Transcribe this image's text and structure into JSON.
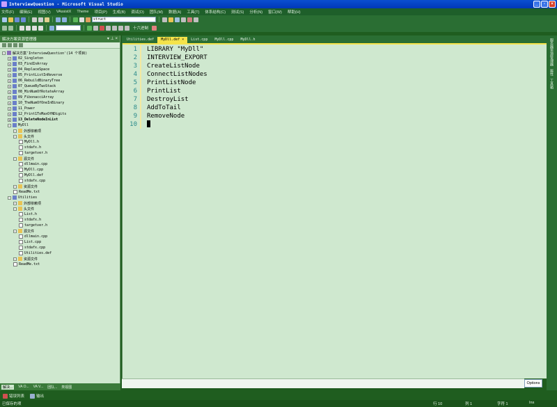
{
  "window": {
    "title": "InterviewQuestion - Microsoft Visual Studio"
  },
  "menu": [
    "文件(F)",
    "编辑(E)",
    "视图(V)",
    "VAssistX",
    "Theme",
    "项目(P)",
    "生成(B)",
    "调试(D)",
    "团队(M)",
    "数据(A)",
    "工具(T)",
    "体系结构(C)",
    "测试(S)",
    "分析(N)",
    "窗口(W)",
    "帮助(H)"
  ],
  "toolbar": {
    "find_combo": "struct",
    "hex_label": "十六进制"
  },
  "solution_explorer": {
    "header": "解决方案资源管理器",
    "rows": [
      {
        "text": "解决方案'InterviewQuestion'(14 个项目)",
        "level": 0,
        "type": "sol",
        "bold": false
      },
      {
        "text": "02_Singleton",
        "level": 1,
        "type": "proj"
      },
      {
        "text": "03_FindInArray",
        "level": 1,
        "type": "proj"
      },
      {
        "text": "04_ReplaceSpace",
        "level": 1,
        "type": "proj"
      },
      {
        "text": "05_PrintListInReverse",
        "level": 1,
        "type": "proj"
      },
      {
        "text": "06_RebuildBinaryTree",
        "level": 1,
        "type": "proj"
      },
      {
        "text": "07_QueueByTwoStack",
        "level": 1,
        "type": "proj"
      },
      {
        "text": "08_MinNumOfRotateArray",
        "level": 1,
        "type": "proj"
      },
      {
        "text": "09_FibonacciArray",
        "level": 1,
        "type": "proj"
      },
      {
        "text": "10_TheNumOfOneInBinary",
        "level": 1,
        "type": "proj"
      },
      {
        "text": "11_Power",
        "level": 1,
        "type": "proj"
      },
      {
        "text": "12_Print1ToMaxOfNDigits",
        "level": 1,
        "type": "proj"
      },
      {
        "text": "13_DeleteNodeInList",
        "level": 1,
        "type": "proj",
        "bold": true
      },
      {
        "text": "MyDll",
        "level": 1,
        "type": "proj"
      },
      {
        "text": "外部依赖项",
        "level": 2,
        "type": "folder"
      },
      {
        "text": "头文件",
        "level": 2,
        "type": "folder"
      },
      {
        "text": "MyDll.h",
        "level": 3,
        "type": "file"
      },
      {
        "text": "stdafx.h",
        "level": 3,
        "type": "file"
      },
      {
        "text": "targetver.h",
        "level": 3,
        "type": "file"
      },
      {
        "text": "源文件",
        "level": 2,
        "type": "folder"
      },
      {
        "text": "dllmain.cpp",
        "level": 3,
        "type": "file"
      },
      {
        "text": "MyDll.cpp",
        "level": 3,
        "type": "file"
      },
      {
        "text": "MyDll.def",
        "level": 3,
        "type": "file"
      },
      {
        "text": "stdafx.cpp",
        "level": 3,
        "type": "file"
      },
      {
        "text": "资源文件",
        "level": 2,
        "type": "folder"
      },
      {
        "text": "ReadMe.txt",
        "level": 2,
        "type": "file"
      },
      {
        "text": "Utilities",
        "level": 1,
        "type": "proj"
      },
      {
        "text": "外部依赖项",
        "level": 2,
        "type": "folder"
      },
      {
        "text": "头文件",
        "level": 2,
        "type": "folder"
      },
      {
        "text": "List.h",
        "level": 3,
        "type": "file"
      },
      {
        "text": "stdafx.h",
        "level": 3,
        "type": "file"
      },
      {
        "text": "targetver.h",
        "level": 3,
        "type": "file"
      },
      {
        "text": "源文件",
        "level": 2,
        "type": "folder"
      },
      {
        "text": "dllmain.cpp",
        "level": 3,
        "type": "file"
      },
      {
        "text": "List.cpp",
        "level": 3,
        "type": "file"
      },
      {
        "text": "stdafx.cpp",
        "level": 3,
        "type": "file"
      },
      {
        "text": "Utilities.def",
        "level": 3,
        "type": "file"
      },
      {
        "text": "资源文件",
        "level": 2,
        "type": "folder"
      },
      {
        "text": "ReadMe.txt",
        "level": 2,
        "type": "file"
      }
    ],
    "bottom_tabs": [
      "解决...",
      "VA O...",
      "VA V...",
      "团队...",
      "类视图"
    ]
  },
  "editor": {
    "tabs": [
      "Utilities.def",
      "MyDll.def",
      "List.cpp",
      "MyDll.cpp",
      "MyDll.h"
    ],
    "active_tab": 1,
    "lines": [
      "LIBRARY \"MyDll\"",
      "INTERVIEW_EXPORT",
      "CreateListNode",
      "ConnectListNodes",
      "PrintListNode",
      "PrintList",
      "DestroyList",
      "AddToTail",
      "RemoveNode",
      ""
    ],
    "options_label": "Options"
  },
  "right_sidebar": [
    "服务器资源管理器",
    "属性",
    "工具箱"
  ],
  "bottom_panel_tabs": [
    "错误列表",
    "输出"
  ],
  "status": {
    "message": "已保存的项",
    "line": "行 10",
    "col": "列 1",
    "char": "字符 1",
    "mode": "Ins"
  }
}
